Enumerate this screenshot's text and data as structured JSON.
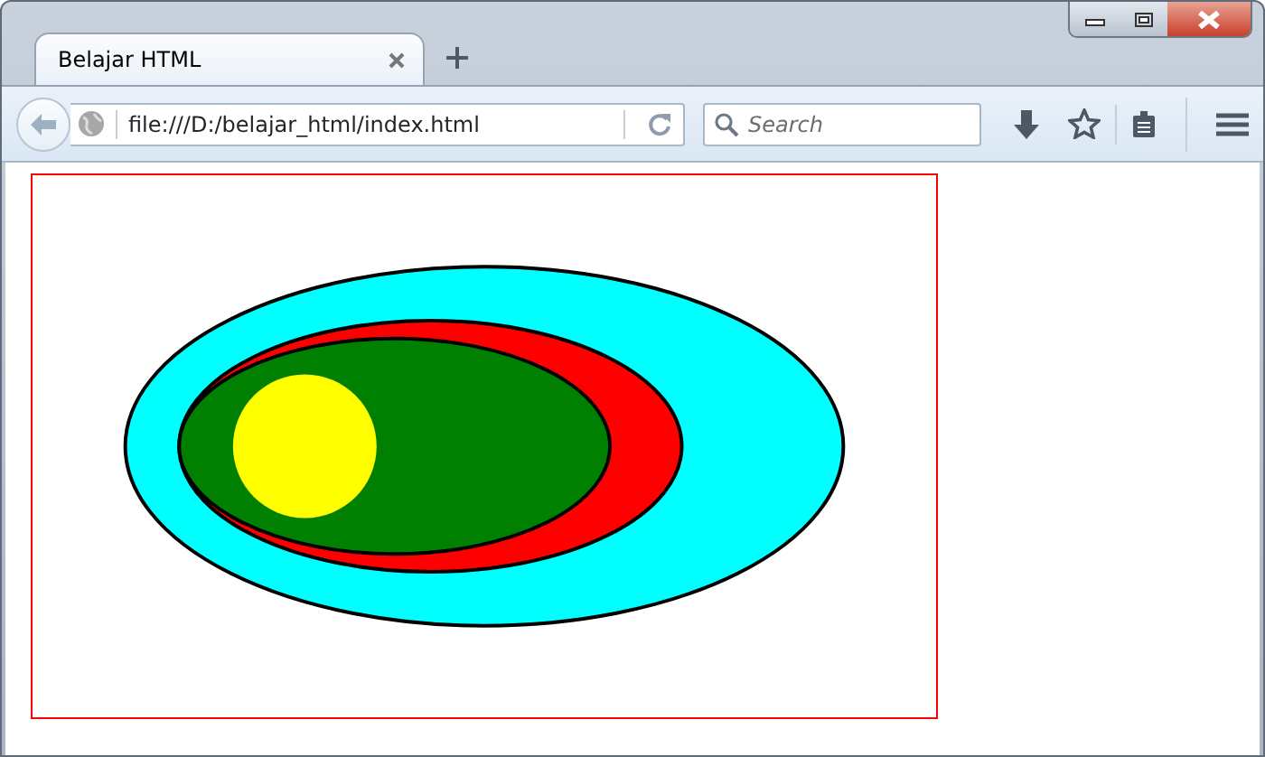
{
  "tabs": [
    {
      "label": "Belajar HTML",
      "selected": true
    }
  ],
  "address_bar": {
    "url": "file:///D:/belajar_html/index.html"
  },
  "search": {
    "placeholder": "Search"
  },
  "canvas": {
    "shapes": [
      {
        "kind": "ellipse",
        "color": "#00ffff"
      },
      {
        "kind": "ellipse",
        "color": "#ff0000"
      },
      {
        "kind": "ellipse",
        "color": "#008000"
      },
      {
        "kind": "circle",
        "color": "#ffff00"
      }
    ]
  }
}
